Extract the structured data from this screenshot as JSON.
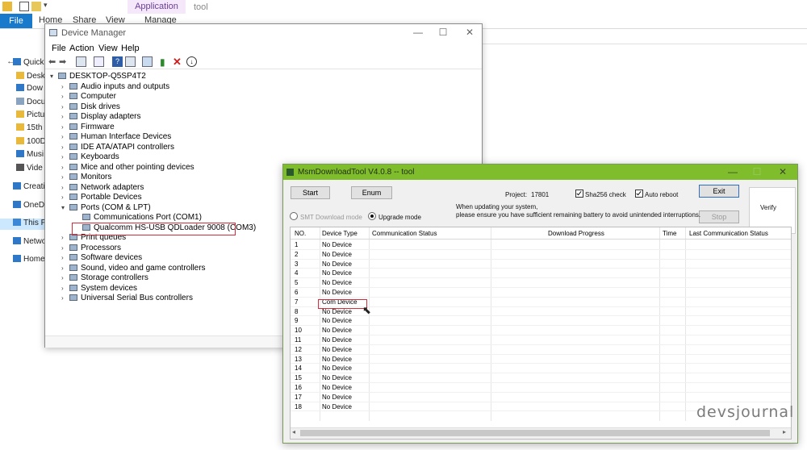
{
  "explorer": {
    "ribbon": {
      "file": "File",
      "home": "Home",
      "share": "Share",
      "view": "View",
      "manage": "Manage",
      "app_tools": "Application Tools",
      "tool": "tool"
    },
    "nav": [
      {
        "label": "Quick",
        "icon": "star-icon"
      },
      {
        "label": "Desk",
        "icon": "folder-icon"
      },
      {
        "label": "Dow",
        "icon": "download-icon"
      },
      {
        "label": "Docu",
        "icon": "document-icon"
      },
      {
        "label": "Pictu",
        "icon": "folder-icon"
      },
      {
        "label": "15th",
        "icon": "folder-icon"
      },
      {
        "label": "100D",
        "icon": "folder-icon"
      },
      {
        "label": "Musi",
        "icon": "music-icon"
      },
      {
        "label": "Vide",
        "icon": "video-icon"
      },
      {
        "label": "Creati",
        "icon": "cloud-icon"
      },
      {
        "label": "OneDr",
        "icon": "cloud-icon"
      },
      {
        "label": "This P",
        "icon": "pc-icon"
      },
      {
        "label": "Netwo",
        "icon": "network-icon"
      },
      {
        "label": "Home",
        "icon": "homegroup-icon"
      }
    ]
  },
  "device_manager": {
    "title": "Device Manager",
    "menu": [
      "File",
      "Action",
      "View",
      "Help"
    ],
    "root": "DESKTOP-Q5SP4T2",
    "categories": [
      "Audio inputs and outputs",
      "Computer",
      "Disk drives",
      "Display adapters",
      "Firmware",
      "Human Interface Devices",
      "IDE ATA/ATAPI controllers",
      "Keyboards",
      "Mice and other pointing devices",
      "Monitors",
      "Network adapters",
      "Portable Devices",
      "Ports (COM & LPT)"
    ],
    "ports": [
      "Communications Port (COM1)",
      "Qualcomm HS-USB QDLoader 9008 (COM3)"
    ],
    "categories_after": [
      "Print queues",
      "Processors",
      "Software devices",
      "Sound, video and game controllers",
      "Storage controllers",
      "System devices",
      "Universal Serial Bus controllers"
    ]
  },
  "msm": {
    "title": "MsmDownloadTool V4.0.8 -- tool",
    "start": "Start",
    "enum": "Enum",
    "project_label": "Project:",
    "project_value": "17801",
    "sha256": "Sha256 check",
    "auto_reboot": "Auto reboot",
    "exit": "Exit",
    "stop": "Stop",
    "verify": "Verify",
    "smt_mode": "SMT Download mode",
    "upgrade_mode": "Upgrade mode",
    "note_line1": "When updating your system,",
    "note_line2": "please ensure you have sufficient remaining battery to avoid unintended interruptions.",
    "columns": [
      "NO.",
      "Device Type",
      "Communication Status",
      "Download Progress",
      "Time",
      "Last Communication Status"
    ],
    "rows": [
      {
        "no": "1",
        "type": "No Device"
      },
      {
        "no": "2",
        "type": "No Device"
      },
      {
        "no": "3",
        "type": "No Device"
      },
      {
        "no": "4",
        "type": "No Device"
      },
      {
        "no": "5",
        "type": "No Device"
      },
      {
        "no": "6",
        "type": "No Device"
      },
      {
        "no": "7",
        "type": "Com Device"
      },
      {
        "no": "8",
        "type": "No Device"
      },
      {
        "no": "9",
        "type": "No Device"
      },
      {
        "no": "10",
        "type": "No Device"
      },
      {
        "no": "11",
        "type": "No Device"
      },
      {
        "no": "12",
        "type": "No Device"
      },
      {
        "no": "13",
        "type": "No Device"
      },
      {
        "no": "14",
        "type": "No Device"
      },
      {
        "no": "15",
        "type": "No Device"
      },
      {
        "no": "16",
        "type": "No Device"
      },
      {
        "no": "17",
        "type": "No Device"
      },
      {
        "no": "18",
        "type": "No Device"
      }
    ]
  },
  "watermark": "devsjournal",
  "colors": {
    "msm_titlebar": "#7fbd2c",
    "highlight": "#d42c3b",
    "file_tab": "#1979ca",
    "app_tools_bg": "#f5e8fb"
  }
}
